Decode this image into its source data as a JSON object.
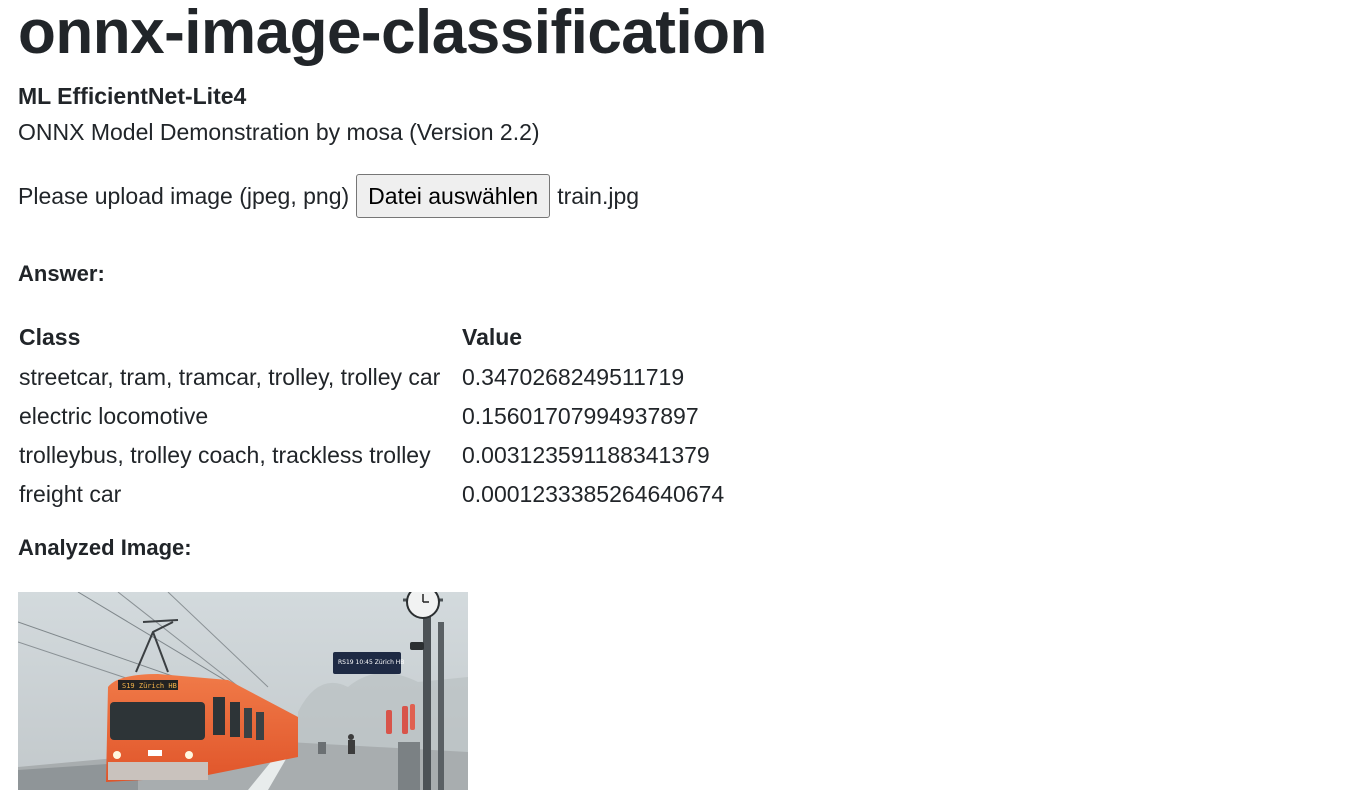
{
  "title": "onnx-image-classification",
  "model_name": "ML EfficientNet-Lite4",
  "description": "ONNX Model Demonstration by mosa (Version 2.2)",
  "upload": {
    "label": "Please upload image (jpeg, png)",
    "button_label": "Datei auswählen",
    "file_name": "train.jpg"
  },
  "answer_heading": "Answer:",
  "results": {
    "headers": [
      "Class",
      "Value"
    ],
    "rows": [
      {
        "cls": "streetcar, tram, tramcar, trolley, trolley car",
        "value": "0.3470268249511719"
      },
      {
        "cls": "electric locomotive",
        "value": "0.15601707994937897"
      },
      {
        "cls": "trolleybus, trolley coach, trackless trolley",
        "value": "0.003123591188341379"
      },
      {
        "cls": "freight car",
        "value": "0.0001233385264640674"
      }
    ]
  },
  "analyzed_heading": "Analyzed Image:",
  "image": {
    "sign_text": "RS19 10:45 Zürich HB",
    "front_text": "S19  Zürich HB"
  }
}
